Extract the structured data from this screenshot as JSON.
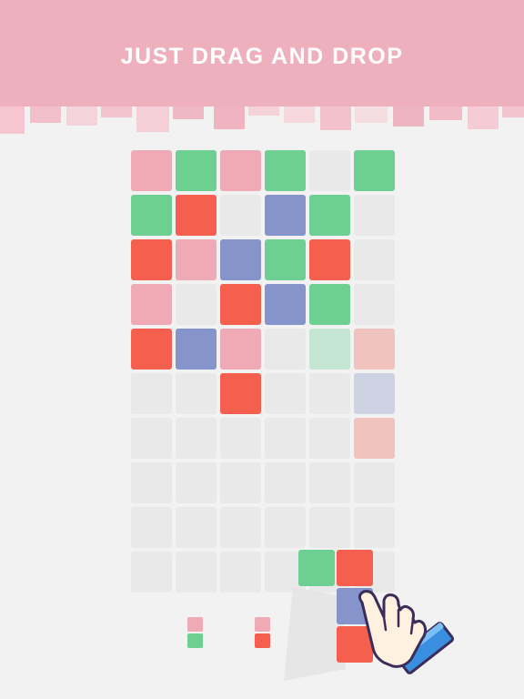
{
  "header": {
    "title": "JUST DRAG AND DROP",
    "background_color": "#efb0be"
  },
  "palette": {
    "E": "#e9e9e9",
    "P": "#efaab5",
    "G": "#6dcf91",
    "R": "#f5604e",
    "B": "#8594ca",
    "g": "#c5e6d2",
    "r": "#f0c3be",
    "b": "#cdd3e3"
  },
  "board": {
    "columns": 6,
    "rows": 10,
    "cells": [
      [
        "P",
        "G",
        "P",
        "G",
        "E",
        "G"
      ],
      [
        "G",
        "R",
        "E",
        "B",
        "G",
        "E"
      ],
      [
        "R",
        "P",
        "B",
        "G",
        "R",
        "E"
      ],
      [
        "P",
        "E",
        "R",
        "B",
        "G",
        "E"
      ],
      [
        "R",
        "B",
        "P",
        "E",
        "g",
        "r"
      ],
      [
        "E",
        "E",
        "R",
        "E",
        "E",
        "b"
      ],
      [
        "E",
        "E",
        "E",
        "E",
        "E",
        "r"
      ],
      [
        "E",
        "E",
        "E",
        "E",
        "E",
        "E"
      ],
      [
        "E",
        "E",
        "E",
        "E",
        "E",
        "E"
      ],
      [
        "E",
        "E",
        "E",
        "E",
        "E",
        "E"
      ]
    ]
  },
  "dragged_piece": {
    "blocks": [
      "G",
      "R",
      "B",
      "R"
    ]
  },
  "tray_pieces": [
    {
      "top": "P",
      "bottom": "G"
    },
    {
      "top": "P",
      "bottom": "R"
    }
  ],
  "hand_icon": "pointing-hand-icon"
}
